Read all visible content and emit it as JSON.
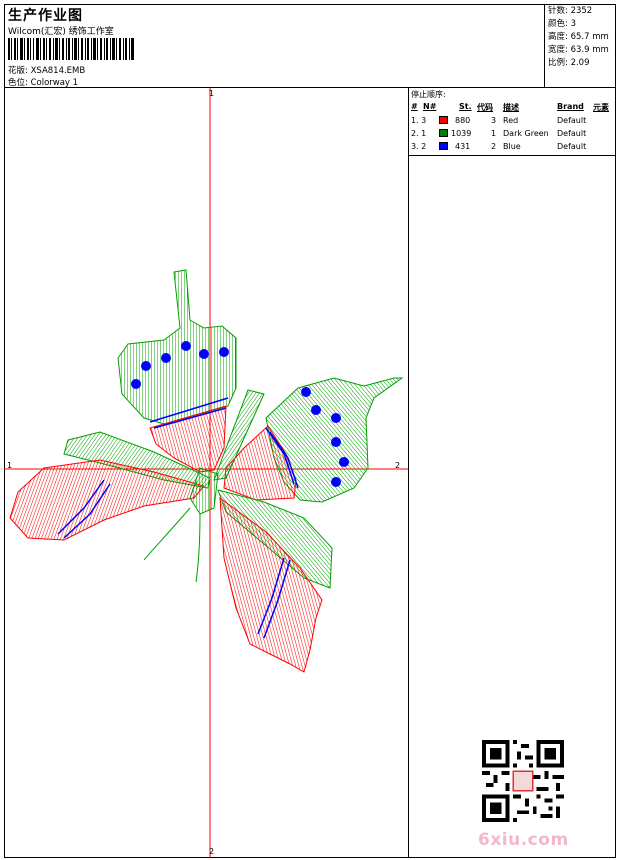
{
  "header": {
    "title": "生产作业图",
    "subtitle": "Wilcom(汇宏) 绣饰工作室",
    "design": "花版: XSA814.EMB",
    "colorway": "色位: Colorway 1"
  },
  "stats": {
    "stitches": "针数: 2352",
    "colors": "颜色: 3",
    "height": "高度: 65.7 mm",
    "width": "宽度: 63.9 mm",
    "scale": "比例: 2.09"
  },
  "stop_sequence": {
    "title": "停止顺序:",
    "columns": {
      "hash": "#",
      "n": "N#",
      "stitches": "St.",
      "code": "代码",
      "description": "描述",
      "brand": "Brand",
      "element": "元素"
    },
    "rows": [
      {
        "index": "1. 3",
        "color": "#ff0000",
        "stitches": "880",
        "code": "3",
        "description": "Red",
        "brand": "Default"
      },
      {
        "index": "2. 1",
        "color": "#008000",
        "stitches": "1039",
        "code": "1",
        "description": "Dark Green",
        "brand": "Default"
      },
      {
        "index": "3. 2",
        "color": "#0000ff",
        "stitches": "431",
        "code": "2",
        "description": "Blue",
        "brand": "Default"
      }
    ]
  },
  "axes": {
    "top": "1",
    "bottom": "2",
    "left": "1",
    "right": "2"
  },
  "watermark": "6xiu.com"
}
